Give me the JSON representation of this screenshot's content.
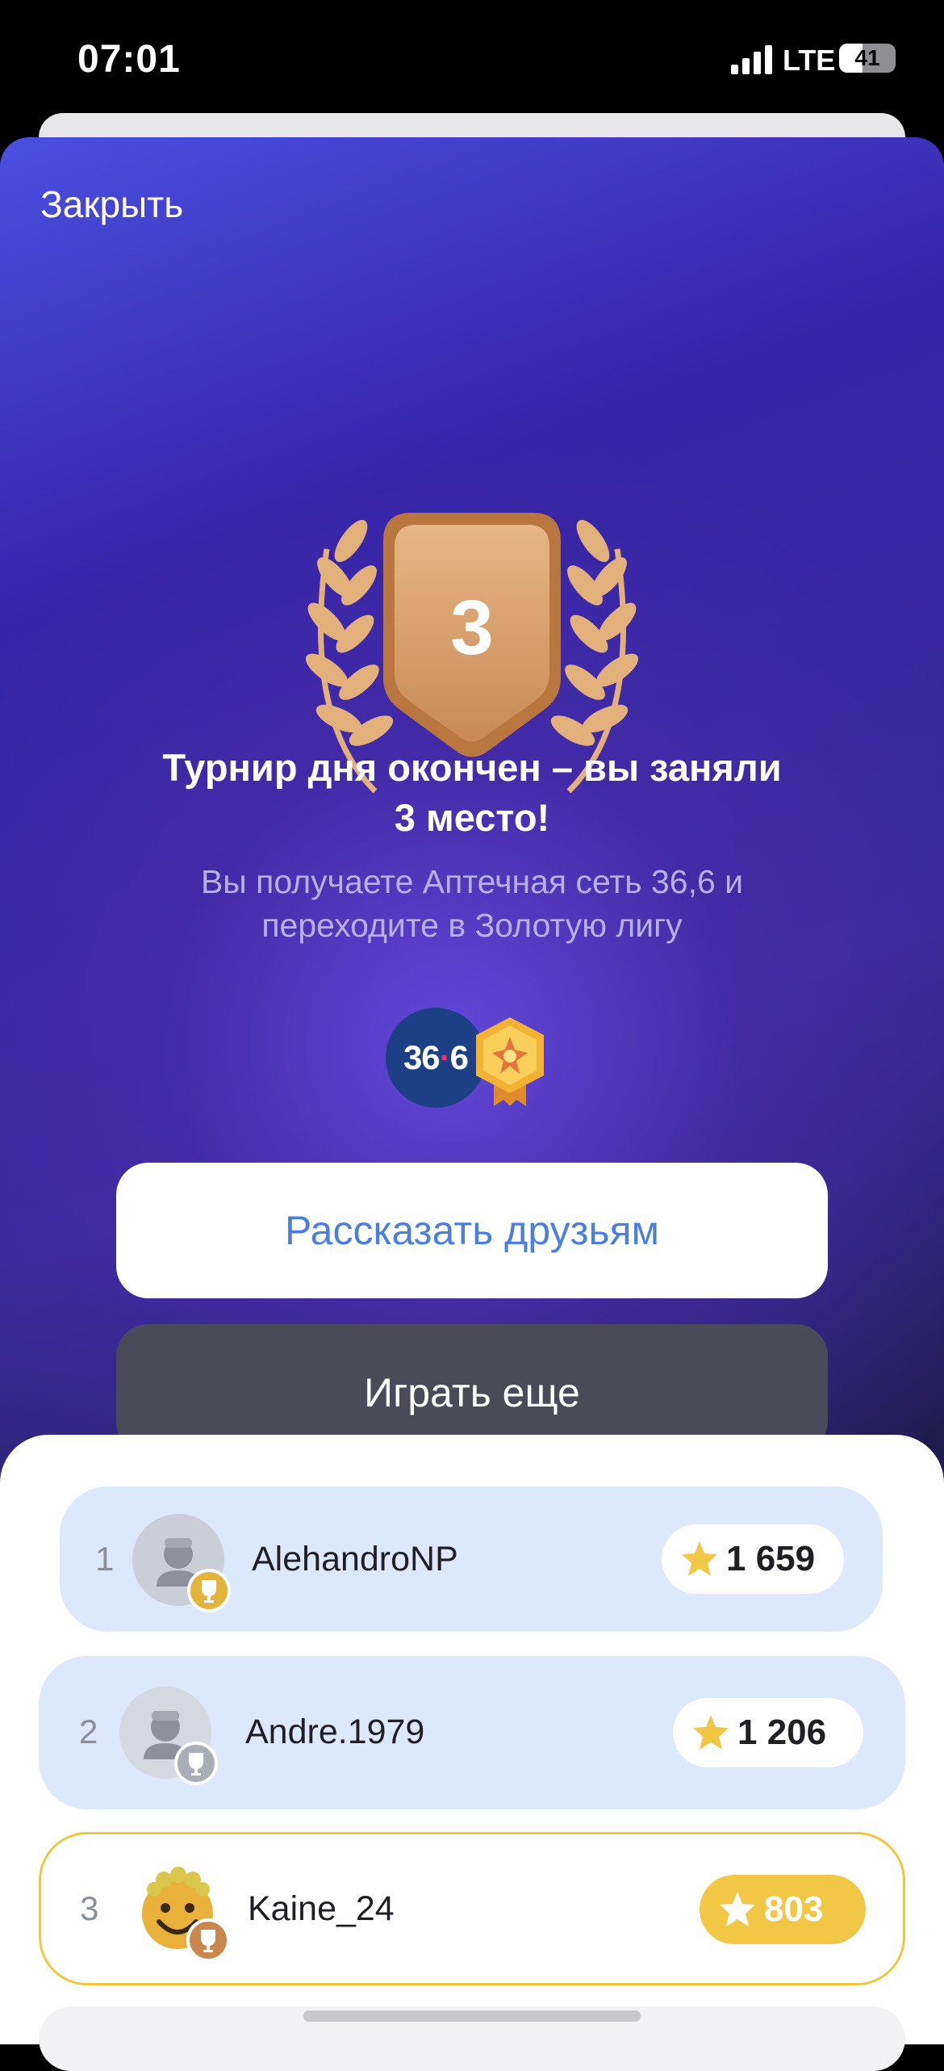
{
  "status": {
    "time": "07:01",
    "network": "LTE",
    "battery": "41",
    "battery_level": 0.41
  },
  "modal": {
    "close_label": "Закрыть",
    "place_number": "3",
    "title_line1": "Турнир дня окончен – вы заняли",
    "title_line2": "3 место!",
    "subtitle_line1": "Вы получаете Аптечная сеть 36,6 и",
    "subtitle_line2": "переходите в Золотую лигу",
    "reward_logo_left": "36",
    "reward_logo_right": "6",
    "share_button": "Рассказать друзьям",
    "play_button": "Играть еще"
  },
  "leaderboard": [
    {
      "rank": "1",
      "name": "AlehandroNP",
      "score": "1 659",
      "trophy": "gold"
    },
    {
      "rank": "2",
      "name": "Andre.1979",
      "score": "1 206",
      "trophy": "silver"
    },
    {
      "rank": "3",
      "name": "Kaine_24",
      "score": "803",
      "trophy": "bronze",
      "current_user": true
    }
  ],
  "colors": {
    "accent_blue": "#4a7fe0",
    "gold": "#f3c746",
    "row_bg": "#dce8fb",
    "medal_bronze": "#d9a06a"
  }
}
